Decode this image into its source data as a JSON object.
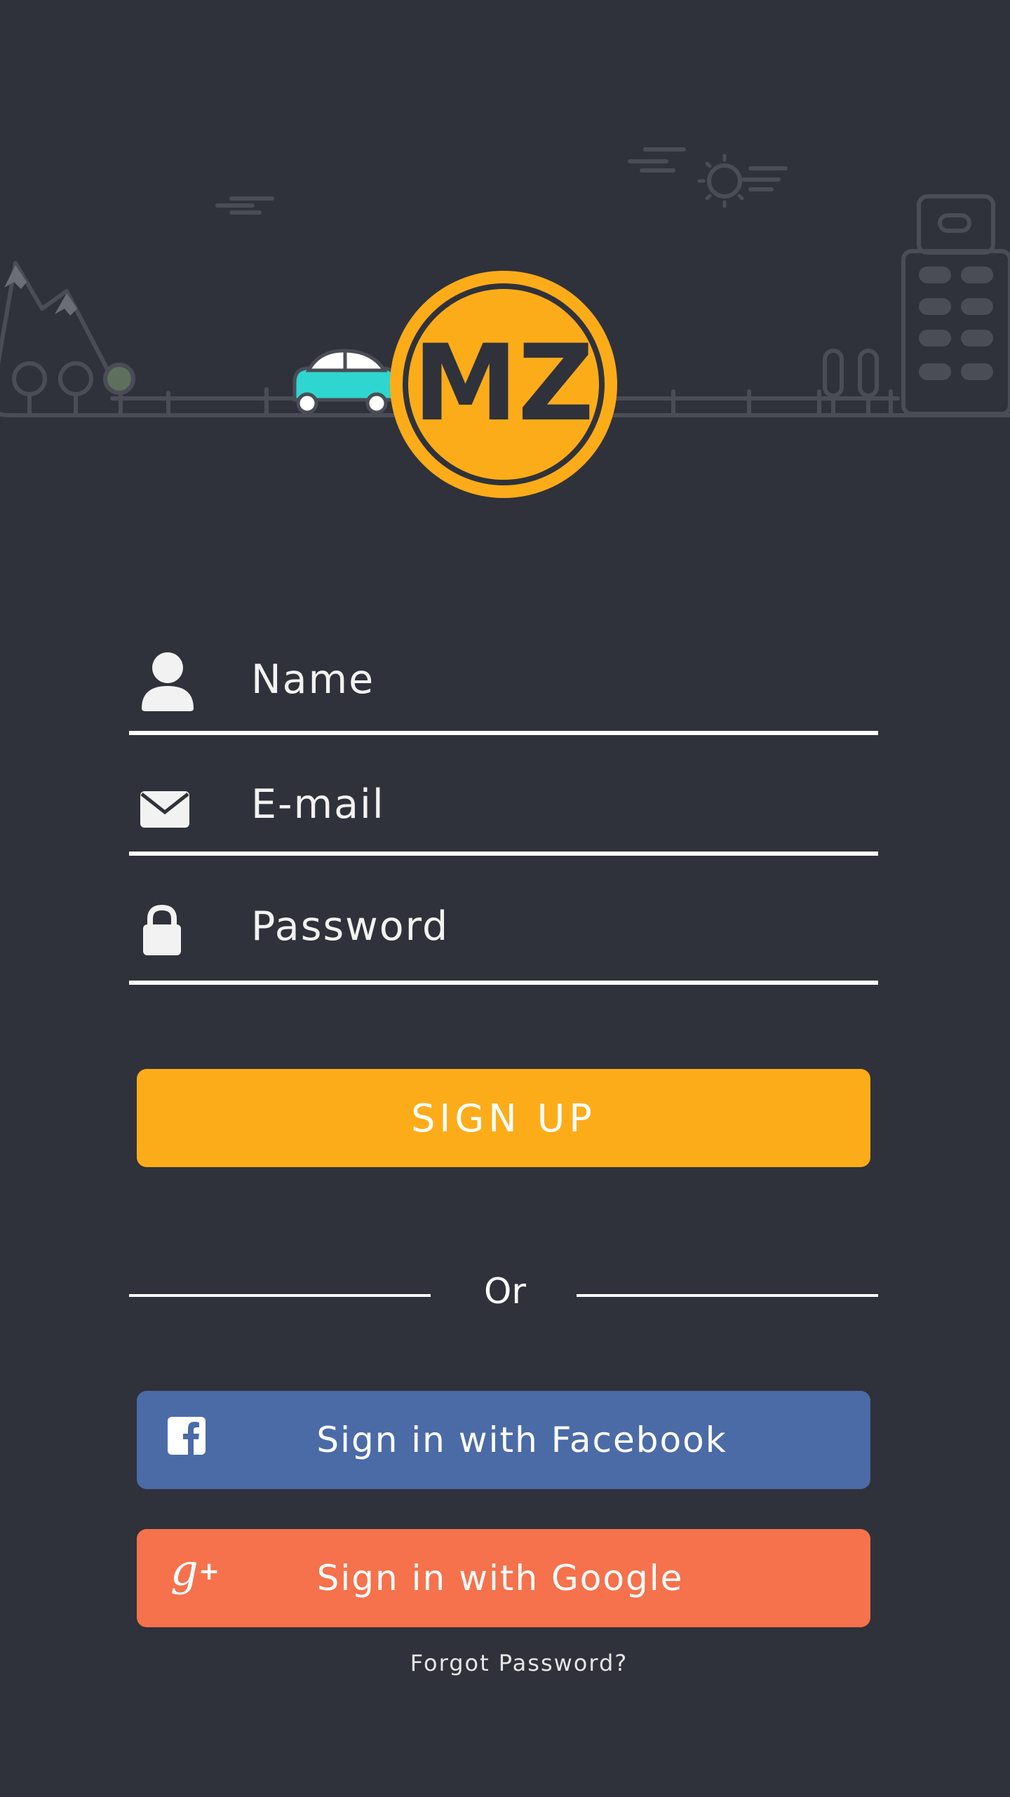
{
  "logo": {
    "text": "MZ"
  },
  "form": {
    "name_placeholder": "Name",
    "email_placeholder": "E-mail",
    "password_placeholder": "Password"
  },
  "buttons": {
    "signup_label": "SIGN UP",
    "facebook_label": "Sign in with Facebook",
    "google_label": "Sign in with Google"
  },
  "divider": {
    "text": "Or"
  },
  "links": {
    "forgot_password": "Forgot Password?"
  },
  "icons": {
    "name": "user-icon",
    "email": "envelope-icon",
    "password": "lock-icon",
    "facebook": "facebook-icon",
    "google": "google-plus-icon"
  },
  "colors": {
    "background": "#2f323a",
    "accent": "#fdac19",
    "facebook": "#4b6ba7",
    "google": "#f5724c",
    "car": "#2fd6cf",
    "illustration_stroke": "#4a4d55"
  }
}
